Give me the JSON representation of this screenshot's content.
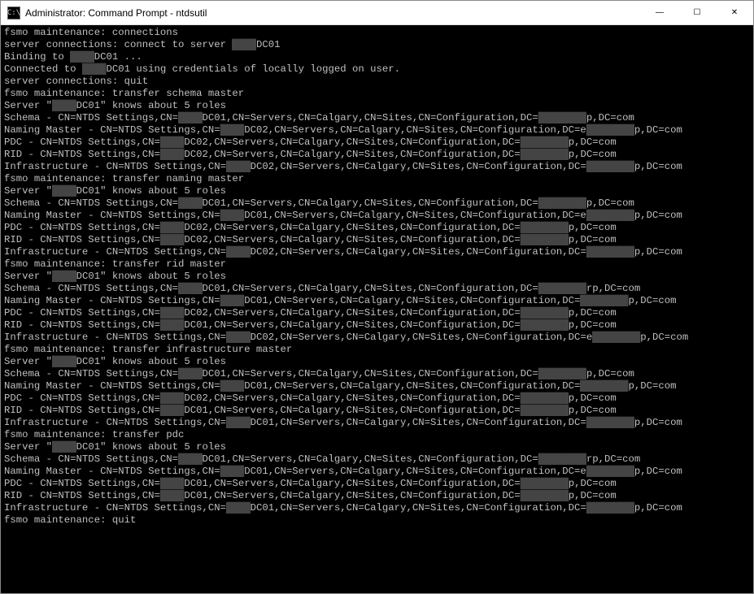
{
  "titlebar": {
    "icon_text": "C:\\",
    "title": "Administrator: Command Prompt - ntdsutil"
  },
  "window_controls": {
    "minimize": "—",
    "maximize": "☐",
    "close": "✕"
  },
  "redacted_prefix": "████",
  "terminal": {
    "lines": [
      {
        "segments": [
          {
            "t": "fsmo maintenance: connections"
          }
        ]
      },
      {
        "segments": [
          {
            "t": "server connections: connect to server "
          },
          {
            "t": "████",
            "r": true
          },
          {
            "t": "DC01"
          }
        ]
      },
      {
        "segments": [
          {
            "t": "Binding to "
          },
          {
            "t": "████",
            "r": true
          },
          {
            "t": "DC01 ..."
          }
        ]
      },
      {
        "segments": [
          {
            "t": "Connected to "
          },
          {
            "t": "████",
            "r": true
          },
          {
            "t": "DC01 using credentials of locally logged on user."
          }
        ]
      },
      {
        "segments": [
          {
            "t": "server connections: quit"
          }
        ]
      },
      {
        "segments": [
          {
            "t": "fsmo maintenance: transfer schema master"
          }
        ]
      },
      {
        "segments": [
          {
            "t": "Server \""
          },
          {
            "t": "████",
            "r": true
          },
          {
            "t": "DC01\" knows about 5 roles"
          }
        ]
      },
      {
        "segments": [
          {
            "t": "Schema - CN=NTDS Settings,CN="
          },
          {
            "t": "████",
            "r": true
          },
          {
            "t": "DC01,CN=Servers,CN=Calgary,CN=Sites,CN=Configuration,DC="
          },
          {
            "t": "████████",
            "r": true
          },
          {
            "t": "p,DC=com"
          }
        ]
      },
      {
        "segments": [
          {
            "t": "Naming Master - CN=NTDS Settings,CN="
          },
          {
            "t": "████",
            "r": true
          },
          {
            "t": "DC02,CN=Servers,CN=Calgary,CN=Sites,CN=Configuration,DC=e"
          },
          {
            "t": "████████",
            "r": true
          },
          {
            "t": "p,DC=com"
          }
        ]
      },
      {
        "segments": [
          {
            "t": "PDC - CN=NTDS Settings,CN="
          },
          {
            "t": "████",
            "r": true
          },
          {
            "t": "DC02,CN=Servers,CN=Calgary,CN=Sites,CN=Configuration,DC="
          },
          {
            "t": "████████",
            "r": true
          },
          {
            "t": "p,DC=com"
          }
        ]
      },
      {
        "segments": [
          {
            "t": "RID - CN=NTDS Settings,CN="
          },
          {
            "t": "████",
            "r": true
          },
          {
            "t": "DC02,CN=Servers,CN=Calgary,CN=Sites,CN=Configuration,DC="
          },
          {
            "t": "████████",
            "r": true
          },
          {
            "t": "p,DC=com"
          }
        ]
      },
      {
        "segments": [
          {
            "t": "Infrastructure - CN=NTDS Settings,CN="
          },
          {
            "t": "████",
            "r": true
          },
          {
            "t": "DC02,CN=Servers,CN=Calgary,CN=Sites,CN=Configuration,DC="
          },
          {
            "t": "████████",
            "r": true
          },
          {
            "t": "p,DC=com"
          }
        ]
      },
      {
        "segments": [
          {
            "t": "fsmo maintenance: transfer naming master"
          }
        ]
      },
      {
        "segments": [
          {
            "t": "Server \""
          },
          {
            "t": "████",
            "r": true
          },
          {
            "t": "DC01\" knows about 5 roles"
          }
        ]
      },
      {
        "segments": [
          {
            "t": "Schema - CN=NTDS Settings,CN="
          },
          {
            "t": "████",
            "r": true
          },
          {
            "t": "DC01,CN=Servers,CN=Calgary,CN=Sites,CN=Configuration,DC="
          },
          {
            "t": "████████",
            "r": true
          },
          {
            "t": "p,DC=com"
          }
        ]
      },
      {
        "segments": [
          {
            "t": "Naming Master - CN=NTDS Settings,CN="
          },
          {
            "t": "████",
            "r": true
          },
          {
            "t": "DC01,CN=Servers,CN=Calgary,CN=Sites,CN=Configuration,DC=e"
          },
          {
            "t": "████████",
            "r": true
          },
          {
            "t": "p,DC=com"
          }
        ]
      },
      {
        "segments": [
          {
            "t": "PDC - CN=NTDS Settings,CN="
          },
          {
            "t": "████",
            "r": true
          },
          {
            "t": "DC02,CN=Servers,CN=Calgary,CN=Sites,CN=Configuration,DC="
          },
          {
            "t": "████████",
            "r": true
          },
          {
            "t": "p,DC=com"
          }
        ]
      },
      {
        "segments": [
          {
            "t": "RID - CN=NTDS Settings,CN="
          },
          {
            "t": "████",
            "r": true
          },
          {
            "t": "DC02,CN=Servers,CN=Calgary,CN=Sites,CN=Configuration,DC="
          },
          {
            "t": "████████",
            "r": true
          },
          {
            "t": "p,DC=com"
          }
        ]
      },
      {
        "segments": [
          {
            "t": "Infrastructure - CN=NTDS Settings,CN="
          },
          {
            "t": "████",
            "r": true
          },
          {
            "t": "DC02,CN=Servers,CN=Calgary,CN=Sites,CN=Configuration,DC="
          },
          {
            "t": "████████",
            "r": true
          },
          {
            "t": "p,DC=com"
          }
        ]
      },
      {
        "segments": [
          {
            "t": "fsmo maintenance: transfer rid master"
          }
        ]
      },
      {
        "segments": [
          {
            "t": "Server \""
          },
          {
            "t": "████",
            "r": true
          },
          {
            "t": "DC01\" knows about 5 roles"
          }
        ]
      },
      {
        "segments": [
          {
            "t": "Schema - CN=NTDS Settings,CN="
          },
          {
            "t": "████",
            "r": true
          },
          {
            "t": "DC01,CN=Servers,CN=Calgary,CN=Sites,CN=Configuration,DC="
          },
          {
            "t": "████████",
            "r": true
          },
          {
            "t": "rp,DC=com"
          }
        ]
      },
      {
        "segments": [
          {
            "t": "Naming Master - CN=NTDS Settings,CN="
          },
          {
            "t": "████",
            "r": true
          },
          {
            "t": "DC01,CN=Servers,CN=Calgary,CN=Sites,CN=Configuration,DC="
          },
          {
            "t": "████████",
            "r": true
          },
          {
            "t": "p,DC=com"
          }
        ]
      },
      {
        "segments": [
          {
            "t": "PDC - CN=NTDS Settings,CN="
          },
          {
            "t": "████",
            "r": true
          },
          {
            "t": "DC02,CN=Servers,CN=Calgary,CN=Sites,CN=Configuration,DC="
          },
          {
            "t": "████████",
            "r": true
          },
          {
            "t": "p,DC=com"
          }
        ]
      },
      {
        "segments": [
          {
            "t": "RID - CN=NTDS Settings,CN="
          },
          {
            "t": "████",
            "r": true
          },
          {
            "t": "DC01,CN=Servers,CN=Calgary,CN=Sites,CN=Configuration,DC="
          },
          {
            "t": "████████",
            "r": true
          },
          {
            "t": "p,DC=com"
          }
        ]
      },
      {
        "segments": [
          {
            "t": "Infrastructure - CN=NTDS Settings,CN="
          },
          {
            "t": "████",
            "r": true
          },
          {
            "t": "DC02,CN=Servers,CN=Calgary,CN=Sites,CN=Configuration,DC=e"
          },
          {
            "t": "████████",
            "r": true
          },
          {
            "t": "p,DC=com"
          }
        ]
      },
      {
        "segments": [
          {
            "t": "fsmo maintenance: transfer infrastructure master"
          }
        ]
      },
      {
        "segments": [
          {
            "t": "Server \""
          },
          {
            "t": "████",
            "r": true
          },
          {
            "t": "DC01\" knows about 5 roles"
          }
        ]
      },
      {
        "segments": [
          {
            "t": "Schema - CN=NTDS Settings,CN="
          },
          {
            "t": "████",
            "r": true
          },
          {
            "t": "DC01,CN=Servers,CN=Calgary,CN=Sites,CN=Configuration,DC="
          },
          {
            "t": "████████",
            "r": true
          },
          {
            "t": "p,DC=com"
          }
        ]
      },
      {
        "segments": [
          {
            "t": "Naming Master - CN=NTDS Settings,CN="
          },
          {
            "t": "████",
            "r": true
          },
          {
            "t": "DC01,CN=Servers,CN=Calgary,CN=Sites,CN=Configuration,DC="
          },
          {
            "t": "████████",
            "r": true
          },
          {
            "t": "p,DC=com"
          }
        ]
      },
      {
        "segments": [
          {
            "t": "PDC - CN=NTDS Settings,CN="
          },
          {
            "t": "████",
            "r": true
          },
          {
            "t": "DC02,CN=Servers,CN=Calgary,CN=Sites,CN=Configuration,DC="
          },
          {
            "t": "████████",
            "r": true
          },
          {
            "t": "p,DC=com"
          }
        ]
      },
      {
        "segments": [
          {
            "t": "RID - CN=NTDS Settings,CN="
          },
          {
            "t": "████",
            "r": true
          },
          {
            "t": "DC01,CN=Servers,CN=Calgary,CN=Sites,CN=Configuration,DC="
          },
          {
            "t": "████████",
            "r": true
          },
          {
            "t": "p,DC=com"
          }
        ]
      },
      {
        "segments": [
          {
            "t": "Infrastructure - CN=NTDS Settings,CN="
          },
          {
            "t": "████",
            "r": true
          },
          {
            "t": "DC01,CN=Servers,CN=Calgary,CN=Sites,CN=Configuration,DC="
          },
          {
            "t": "████████",
            "r": true
          },
          {
            "t": "p,DC=com"
          }
        ]
      },
      {
        "segments": [
          {
            "t": "fsmo maintenance: transfer pdc"
          }
        ]
      },
      {
        "segments": [
          {
            "t": "Server \""
          },
          {
            "t": "████",
            "r": true
          },
          {
            "t": "DC01\" knows about 5 roles"
          }
        ]
      },
      {
        "segments": [
          {
            "t": "Schema - CN=NTDS Settings,CN="
          },
          {
            "t": "████",
            "r": true
          },
          {
            "t": "DC01,CN=Servers,CN=Calgary,CN=Sites,CN=Configuration,DC="
          },
          {
            "t": "████████",
            "r": true
          },
          {
            "t": "rp,DC=com"
          }
        ]
      },
      {
        "segments": [
          {
            "t": "Naming Master - CN=NTDS Settings,CN="
          },
          {
            "t": "████",
            "r": true
          },
          {
            "t": "DC01,CN=Servers,CN=Calgary,CN=Sites,CN=Configuration,DC=e"
          },
          {
            "t": "████████",
            "r": true
          },
          {
            "t": "p,DC=com"
          }
        ]
      },
      {
        "segments": [
          {
            "t": "PDC - CN=NTDS Settings,CN="
          },
          {
            "t": "████",
            "r": true
          },
          {
            "t": "DC01,CN=Servers,CN=Calgary,CN=Sites,CN=Configuration,DC="
          },
          {
            "t": "████████",
            "r": true
          },
          {
            "t": "p,DC=com"
          }
        ]
      },
      {
        "segments": [
          {
            "t": "RID - CN=NTDS Settings,CN="
          },
          {
            "t": "████",
            "r": true
          },
          {
            "t": "DC01,CN=Servers,CN=Calgary,CN=Sites,CN=Configuration,DC="
          },
          {
            "t": "████████",
            "r": true
          },
          {
            "t": "p,DC=com"
          }
        ]
      },
      {
        "segments": [
          {
            "t": "Infrastructure - CN=NTDS Settings,CN="
          },
          {
            "t": "████",
            "r": true
          },
          {
            "t": "DC01,CN=Servers,CN=Calgary,CN=Sites,CN=Configuration,DC="
          },
          {
            "t": "████████",
            "r": true
          },
          {
            "t": "p,DC=com"
          }
        ]
      },
      {
        "segments": [
          {
            "t": "fsmo maintenance: quit"
          }
        ]
      }
    ]
  }
}
